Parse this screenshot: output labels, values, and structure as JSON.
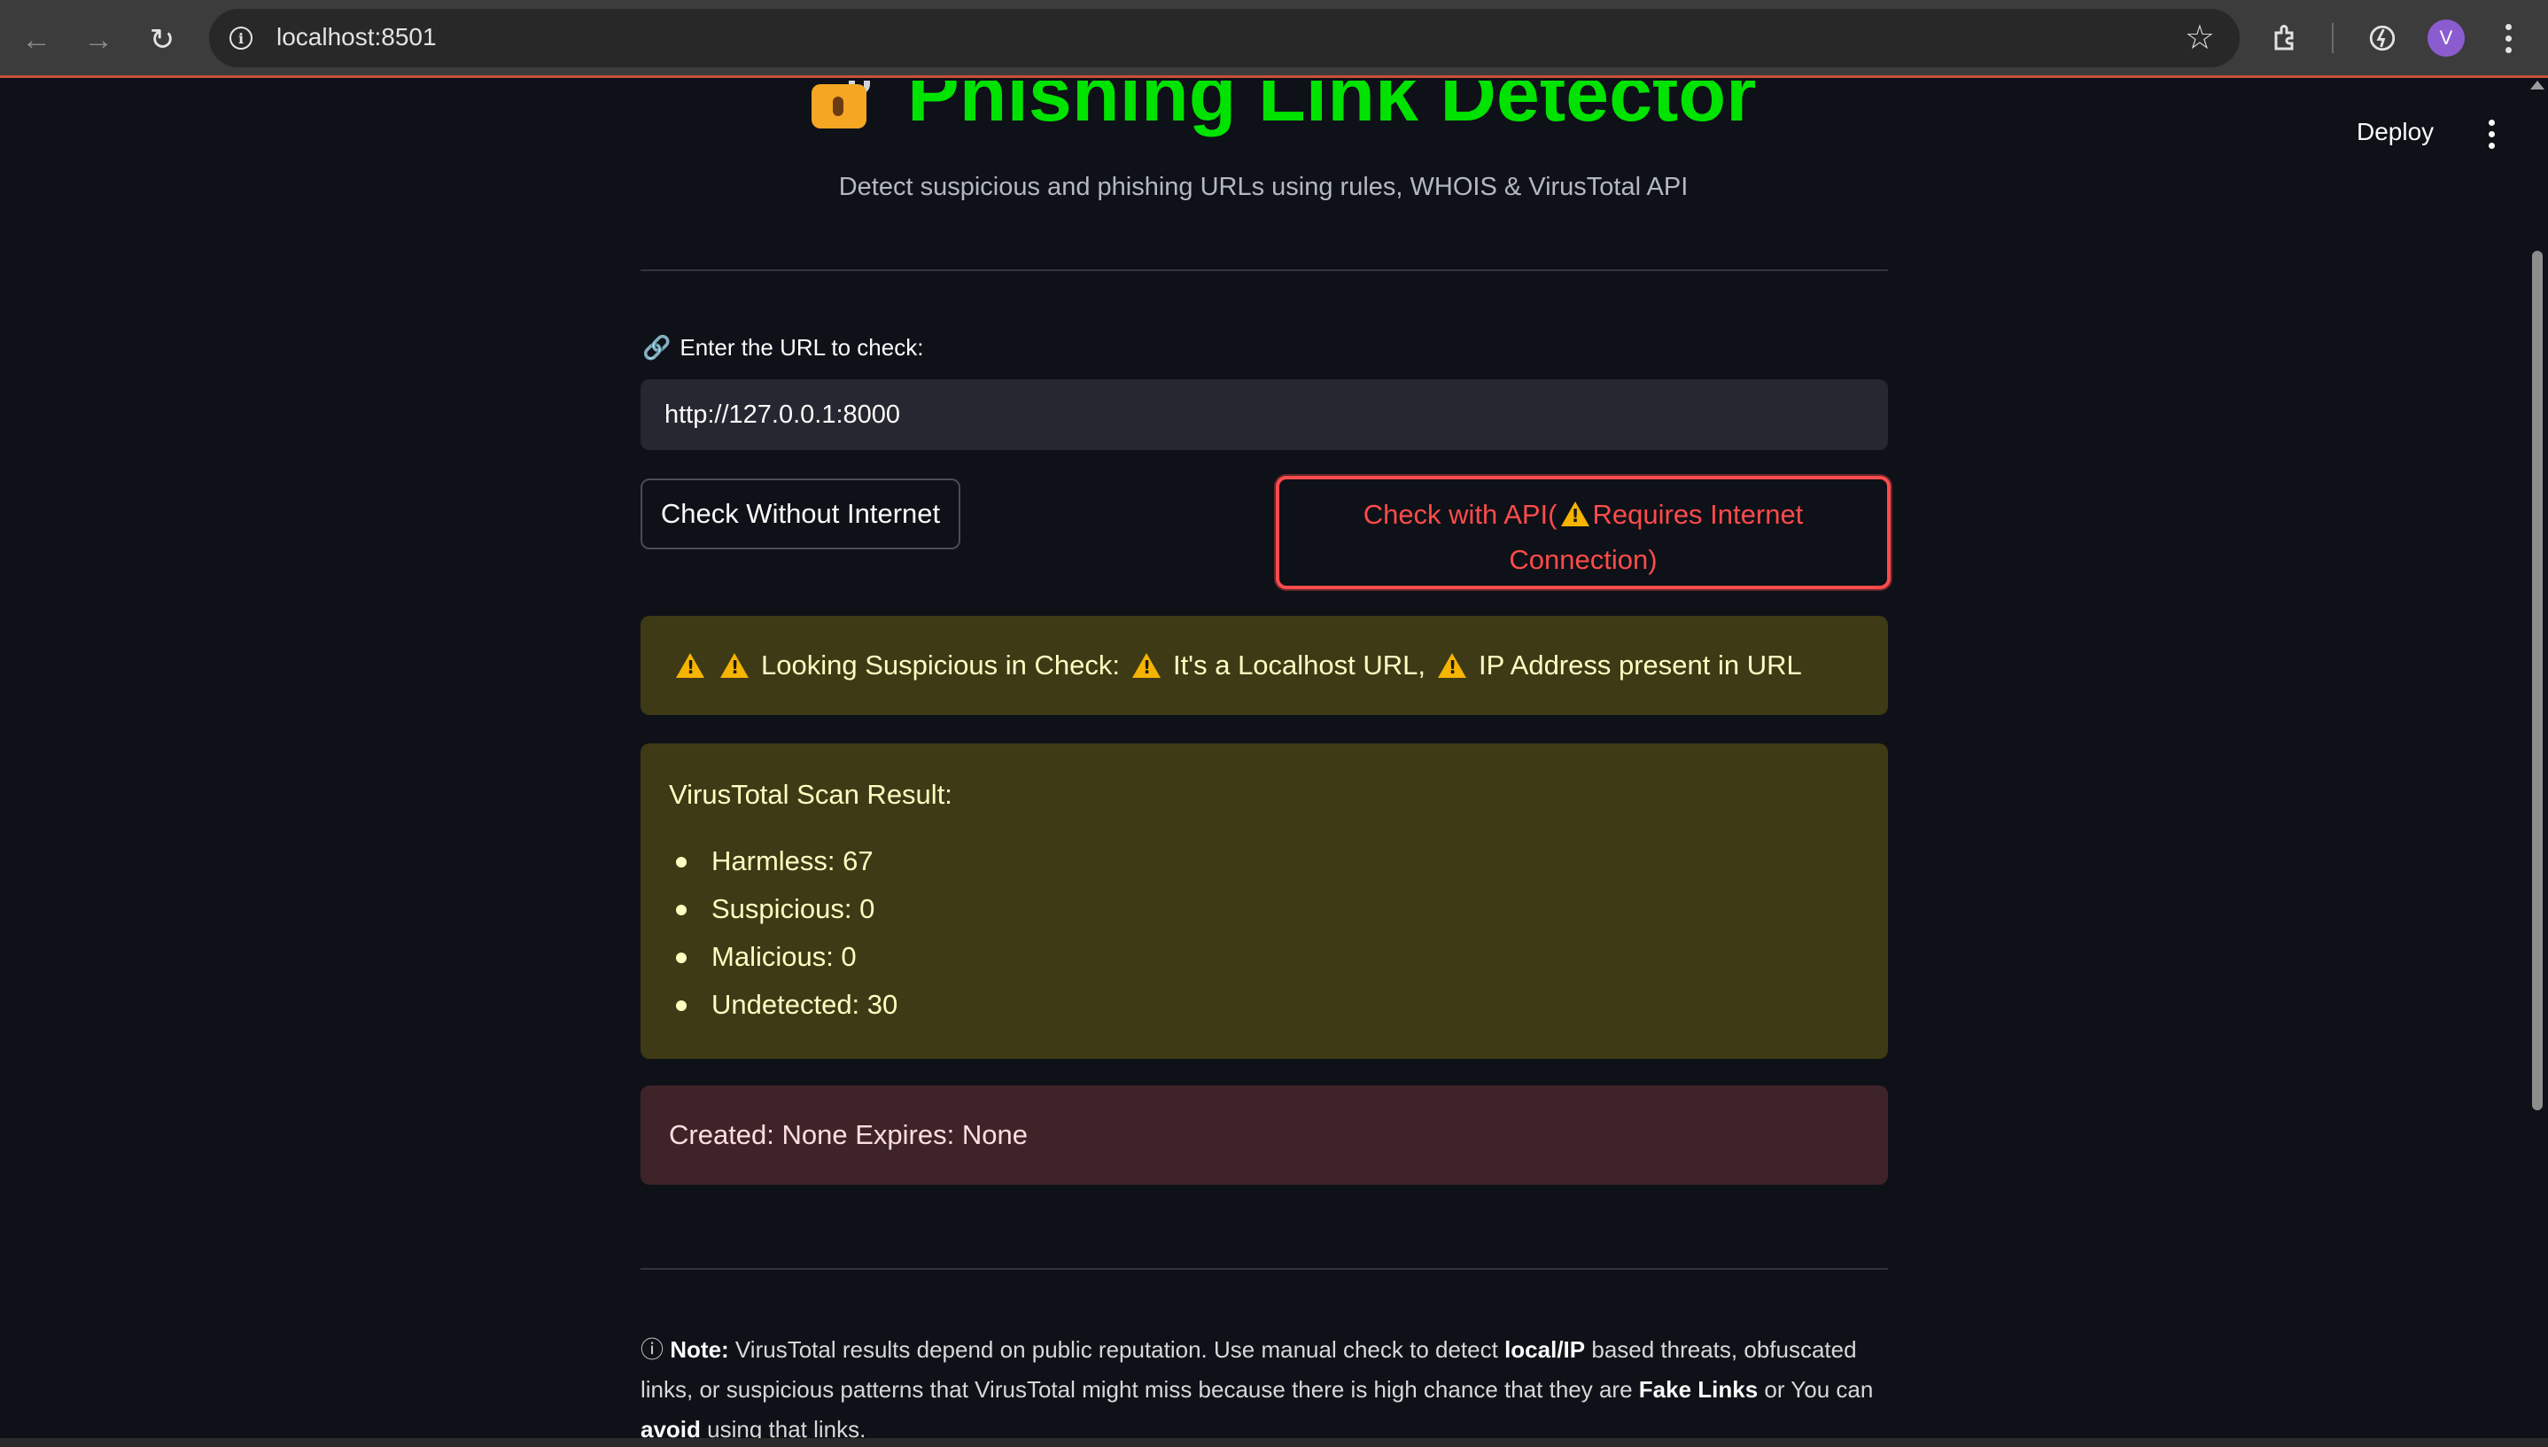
{
  "browser": {
    "url": "localhost:8501",
    "avatar_letter": "V",
    "icons": [
      "back-arrow-icon",
      "forward-arrow-icon",
      "reload-icon",
      "site-info-icon",
      "bookmark-star-icon",
      "extensions-icon",
      "performance-icon",
      "more-menu-icon"
    ]
  },
  "app": {
    "deploy_label": "Deploy",
    "title": "Phishing Link Detector",
    "subtitle": "Detect suspicious and phishing URLs using rules, WHOIS & VirusTotal API",
    "url_label": "Enter the URL to check:",
    "url_value": "http://127.0.0.1:8000",
    "btn_offline": "Check Without Internet",
    "btn_api_prefix": "Check with API(",
    "btn_api_line1_suffix": "Requires Internet",
    "btn_api_line2": "Connection)",
    "warning": {
      "lead": "Looking Suspicious in Check:",
      "item1": "It's a Localhost URL,",
      "item2": "IP Address present in URL"
    },
    "virustotal": {
      "title": "VirusTotal Scan Result:",
      "items": [
        "Harmless: 67",
        "Suspicious: 0",
        "Malicious: 0",
        "Undetected: 30"
      ]
    },
    "whois": "Created: None Expires: None",
    "note": {
      "icon": "ⓘ",
      "label": "Note:",
      "t1": "VirusTotal results depend on public reputation. Use manual check to detect",
      "b1": "local/IP",
      "t2": "based threats, obfuscated links, or suspicious patterns that VirusTotal might miss because there is high chance that they are",
      "b2": "Fake Links",
      "t3": "or You can",
      "b3": "avoid",
      "t4": "using that links."
    },
    "colors": {
      "title": "#00e300",
      "api_button": "#ff4b4b",
      "warning_bg": "#3e3a16",
      "error_bg": "#3e2429"
    }
  }
}
